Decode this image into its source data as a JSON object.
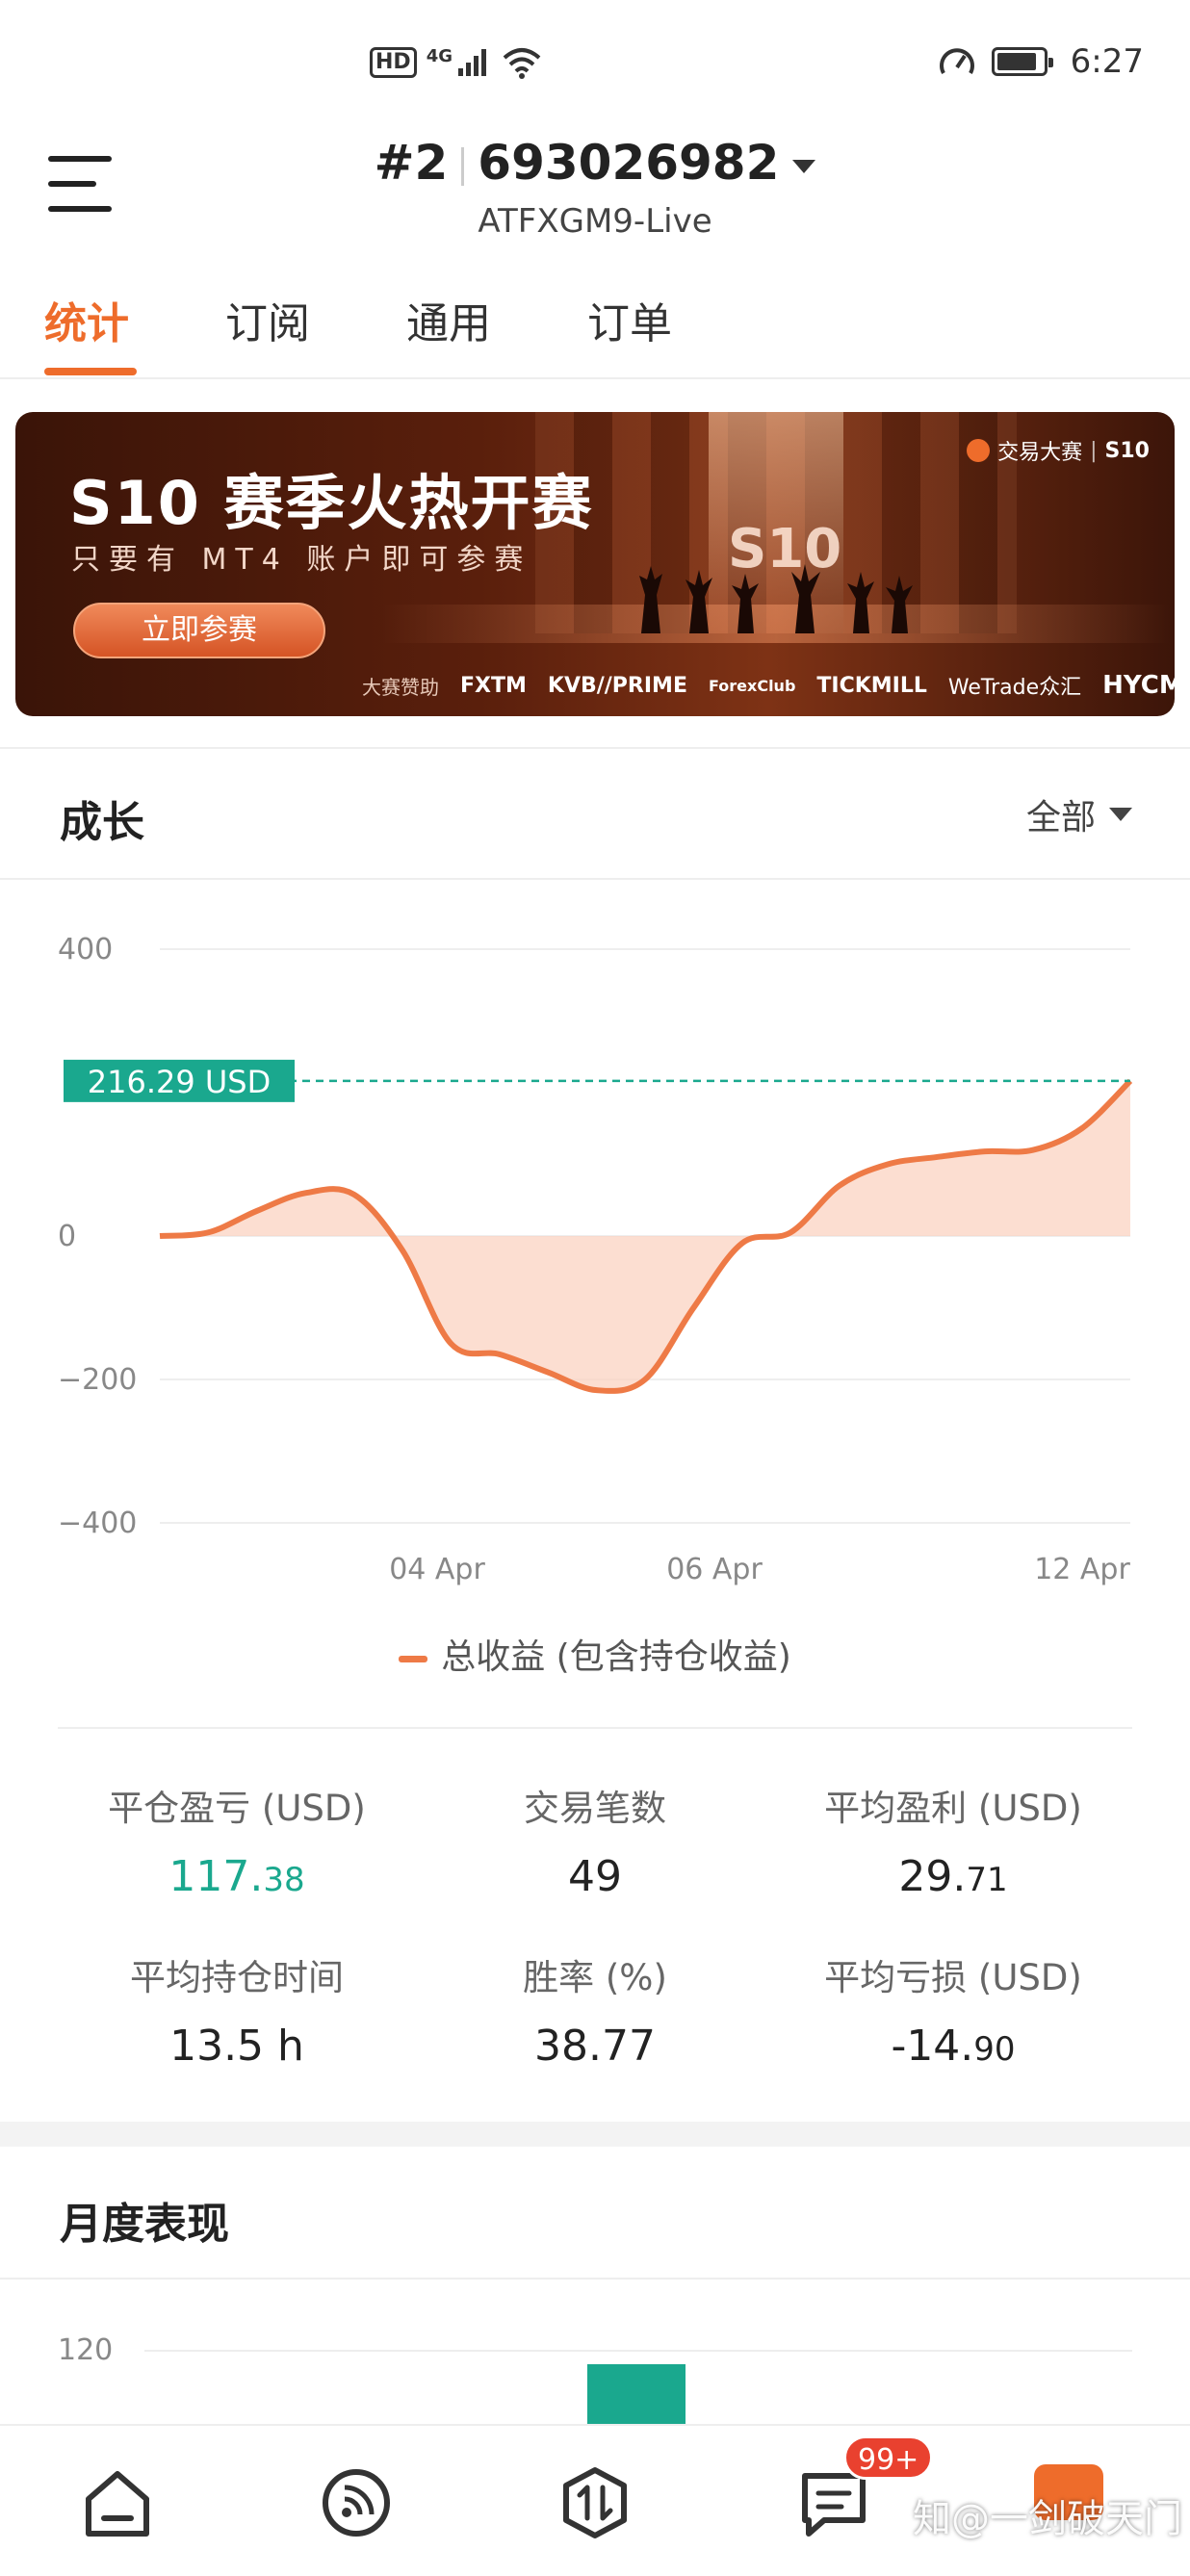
{
  "status_bar": {
    "hd": "HD",
    "net": "4G",
    "time": "6:27"
  },
  "header": {
    "account_index": "#2",
    "account_number": "693026982",
    "server": "ATFXGM9-Live"
  },
  "tabs": [
    {
      "label": "统计",
      "active": true
    },
    {
      "label": "订阅",
      "active": false
    },
    {
      "label": "通用",
      "active": false
    },
    {
      "label": "订单",
      "active": false
    }
  ],
  "banner": {
    "title": "S10 赛季火热开赛",
    "subtitle": "只要有 MT4 账户即可参赛",
    "button": "立即参赛",
    "badge_text": "S10",
    "brand": "交易大赛",
    "brand_tag": "S10",
    "sponsor_label": "大赛赞助",
    "sponsors": [
      "FXTM",
      "KVB//PRIME",
      "ForexClub",
      "TICKMILL",
      "WeTrade众汇",
      "HYCM"
    ]
  },
  "growth": {
    "title": "成长",
    "range": "全部",
    "legend": "总收益 (包含持仓收益)"
  },
  "chart_data": {
    "type": "area",
    "title": "",
    "xlabel": "",
    "ylabel": "",
    "ylim": [
      -400,
      400
    ],
    "y_ticks": [
      400,
      0,
      -200,
      -400
    ],
    "x_ticks": [
      "04 Apr",
      "06 Apr",
      "12 Apr"
    ],
    "current_label": "216.29 USD",
    "current_value": 216.29,
    "grid": true,
    "colors": {
      "line": "#ee7a46",
      "fill": "#fbd3c2",
      "marker": "#1aa88e"
    },
    "series": [
      {
        "name": "总收益 (包含持仓收益)",
        "values": [
          0,
          5,
          35,
          60,
          58,
          -20,
          -150,
          -165,
          -190,
          -215,
          -200,
          -100,
          -10,
          5,
          70,
          100,
          110,
          118,
          120,
          150,
          216.29
        ]
      }
    ]
  },
  "stats": [
    {
      "label": "平仓盈亏 (USD)",
      "int": "117.",
      "dec": "38",
      "green": true
    },
    {
      "label": "交易笔数",
      "int": "49",
      "dec": "",
      "green": false
    },
    {
      "label": "平均盈利 (USD)",
      "int": "29.",
      "dec": "71",
      "green": false
    },
    {
      "label": "平均持仓时间",
      "int": "13.5 h",
      "dec": "",
      "green": false
    },
    {
      "label": "胜率 (%)",
      "int": "38.77",
      "dec": "",
      "green": false
    },
    {
      "label": "平均亏损 (USD)",
      "int": "-14.",
      "dec": "90",
      "green": false
    }
  ],
  "monthly": {
    "title": "月度表现",
    "y_top": "120"
  },
  "bottom_nav": {
    "items": [
      "home-icon",
      "feed-icon",
      "trade-icon",
      "messages-icon",
      "profile-icon"
    ],
    "badge": "99+"
  },
  "watermark": "知@一剑破天门"
}
